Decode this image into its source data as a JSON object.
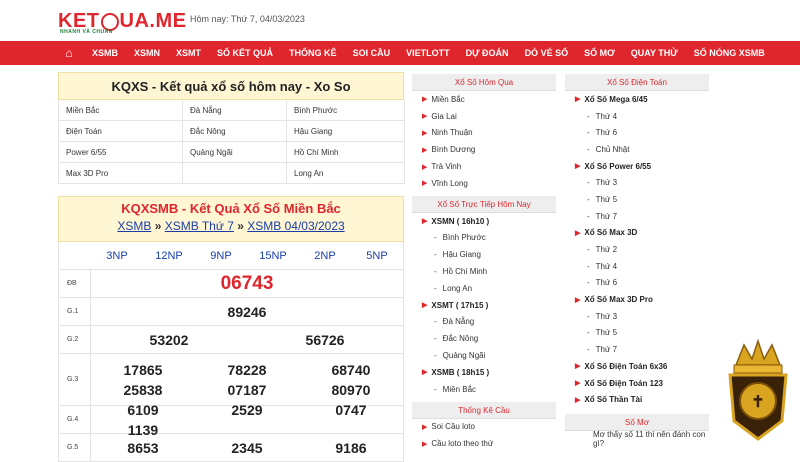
{
  "header": {
    "logo_left": "KET",
    "logo_right": "UA.ME",
    "logo_sub": "NHANH VÀ CHUẨN",
    "date": "Hôm nay: Thứ 7, 04/03/2023"
  },
  "nav": [
    "XSMB",
    "XSMN",
    "XSMT",
    "SỐ KẾT QUẢ",
    "THỐNG KÊ",
    "SOI CẦU",
    "VIETLOTT",
    "DỰ ĐOÁN",
    "DÒ VÉ SỐ",
    "SỐ MƠ",
    "QUAY THỬ",
    "SỐ NÓNG XSMB"
  ],
  "kqxs": {
    "title": "KQXS - Kết quả xổ số hôm nay - Xo So",
    "links": [
      "Miền Bắc",
      "Đà Nẵng",
      "Bình Phước",
      "Điện Toán",
      "Đắc Nông",
      "Hậu Giang",
      "Power 6/55",
      "Quảng Ngãi",
      "Hồ Chí Minh",
      "Max 3D Pro",
      "",
      "Long An"
    ]
  },
  "result": {
    "title": "KQXSMB - Kết Quả Xổ Số Miền Bắc",
    "crumb1": "XSMB",
    "crumb2": "XSMB Thứ 7",
    "crumb3": "XSMB 04/03/2023",
    "sep": "»",
    "codes": [
      "3NP",
      "12NP",
      "9NP",
      "15NP",
      "2NP",
      "5NP"
    ],
    "rows": [
      {
        "label": "ĐB",
        "values": [
          "06743"
        ]
      },
      {
        "label": "G.1",
        "values": [
          "89246"
        ]
      },
      {
        "label": "G.2",
        "values": [
          "53202",
          "56726"
        ]
      },
      {
        "label": "G.3",
        "values": [
          "17865",
          "78228",
          "68740",
          "25838",
          "07187",
          "80970"
        ]
      },
      {
        "label": "G.4",
        "values": [
          "6109",
          "2529",
          "0747",
          "1139"
        ]
      },
      {
        "label": "G.5",
        "values": [
          "8653",
          "2345",
          "9186"
        ]
      }
    ]
  },
  "sidebar1": {
    "title": "Xổ Số Hôm Qua",
    "items": [
      "Miền Bắc",
      "Gia Lai",
      "Ninh Thuận",
      "Bình Dương",
      "Trà Vinh",
      "Vĩnh Long"
    ],
    "live_title": "Xổ Số Trực Tiếp Hôm Nay",
    "live": [
      {
        "name": "XSMN ( 16h10 )",
        "subs": [
          "Bình Phước",
          "Hậu Giang",
          "Hồ Chí Minh",
          "Long An"
        ]
      },
      {
        "name": "XSMT ( 17h15 )",
        "subs": [
          "Đà Nẵng",
          "Đắc Nông",
          "Quảng Ngãi"
        ]
      },
      {
        "name": "XSMB ( 18h15 )",
        "subs": [
          "Miền Bắc"
        ]
      }
    ],
    "stats_title": "Thống Kê Cầu",
    "stats": [
      "Soi Cầu loto",
      "Cầu loto theo thứ"
    ]
  },
  "sidebar2": {
    "title": "Xổ Số Điện Toán",
    "groups": [
      {
        "name": "Xổ Số Mega 6/45",
        "subs": [
          "Thứ 4",
          "Thứ 6",
          "Chủ Nhật"
        ]
      },
      {
        "name": "Xổ Số Power 6/55",
        "subs": [
          "Thứ 3",
          "Thứ 5",
          "Thứ 7"
        ]
      },
      {
        "name": "Xổ Số Max 3D",
        "subs": [
          "Thứ 2",
          "Thứ 4",
          "Thứ 6"
        ]
      },
      {
        "name": "Xổ Số Max 3D Pro",
        "subs": [
          "Thứ 3",
          "Thứ 5",
          "Thứ 7"
        ]
      },
      {
        "name": "Xổ Số Điện Toán 6x36",
        "subs": []
      },
      {
        "name": "Xổ Số Điện Toán 123",
        "subs": []
      },
      {
        "name": "Xổ Số Thần Tài",
        "subs": []
      }
    ],
    "somo_title": "Số Mơ",
    "somo_text": "Mơ thấy số 11 thì nên đánh con gì?"
  },
  "colors": {
    "accent": "#e0262d",
    "link": "#1a3ea8",
    "title_bg": "#fff6d4"
  }
}
